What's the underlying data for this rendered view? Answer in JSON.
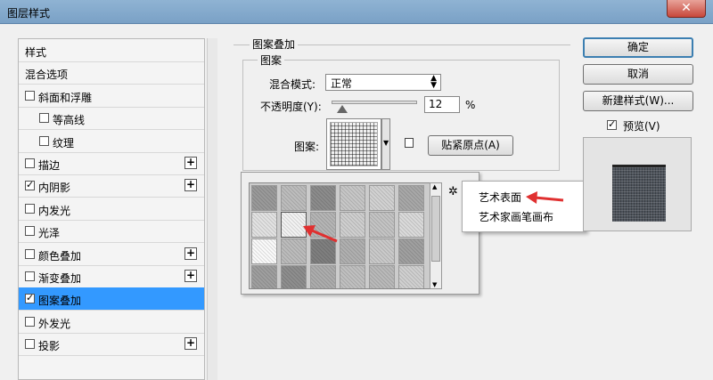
{
  "window": {
    "title": "图层样式",
    "close_glyph": "✕"
  },
  "sidebar": {
    "items": [
      {
        "label": "样式",
        "checkbox": false,
        "checked": false,
        "plus": false
      },
      {
        "label": "混合选项",
        "checkbox": false,
        "checked": false,
        "plus": false
      },
      {
        "label": "斜面和浮雕",
        "checkbox": true,
        "checked": false,
        "plus": false
      },
      {
        "label": "等高线",
        "checkbox": true,
        "checked": false,
        "plus": false
      },
      {
        "label": "纹理",
        "checkbox": true,
        "checked": false,
        "plus": false
      },
      {
        "label": "描边",
        "checkbox": true,
        "checked": false,
        "plus": true
      },
      {
        "label": "内阴影",
        "checkbox": true,
        "checked": true,
        "plus": true
      },
      {
        "label": "内发光",
        "checkbox": true,
        "checked": false,
        "plus": false
      },
      {
        "label": "光泽",
        "checkbox": true,
        "checked": false,
        "plus": false
      },
      {
        "label": "颜色叠加",
        "checkbox": true,
        "checked": false,
        "plus": true
      },
      {
        "label": "渐变叠加",
        "checkbox": true,
        "checked": false,
        "plus": true
      },
      {
        "label": "图案叠加",
        "checkbox": true,
        "checked": true,
        "plus": false
      },
      {
        "label": "外发光",
        "checkbox": true,
        "checked": false,
        "plus": false
      },
      {
        "label": "投影",
        "checkbox": true,
        "checked": false,
        "plus": true
      }
    ],
    "selected_label": "图案叠加",
    "plus_glyph": "+"
  },
  "panel": {
    "section_title": "图案叠加",
    "group_title": "图案",
    "blend_mode_label": "混合模式:",
    "blend_mode_value": "正常",
    "opacity_label": "不透明度(Y):",
    "opacity_value": "12",
    "opacity_unit": "%",
    "pattern_label": "图案:",
    "snap_origin_button": "贴紧原点(A)"
  },
  "popup_menu": {
    "items": [
      "艺术表面",
      "艺术家画笔画布"
    ],
    "highlighted": "艺术表面"
  },
  "right_buttons": {
    "ok": "确定",
    "cancel": "取消",
    "new_style": "新建样式(W)...",
    "preview_label": "预览(V)",
    "preview_checked": true
  },
  "colors": {
    "selection": "#3399ff",
    "arrow": "#e03030",
    "titlebar": "#7aa1c6"
  }
}
